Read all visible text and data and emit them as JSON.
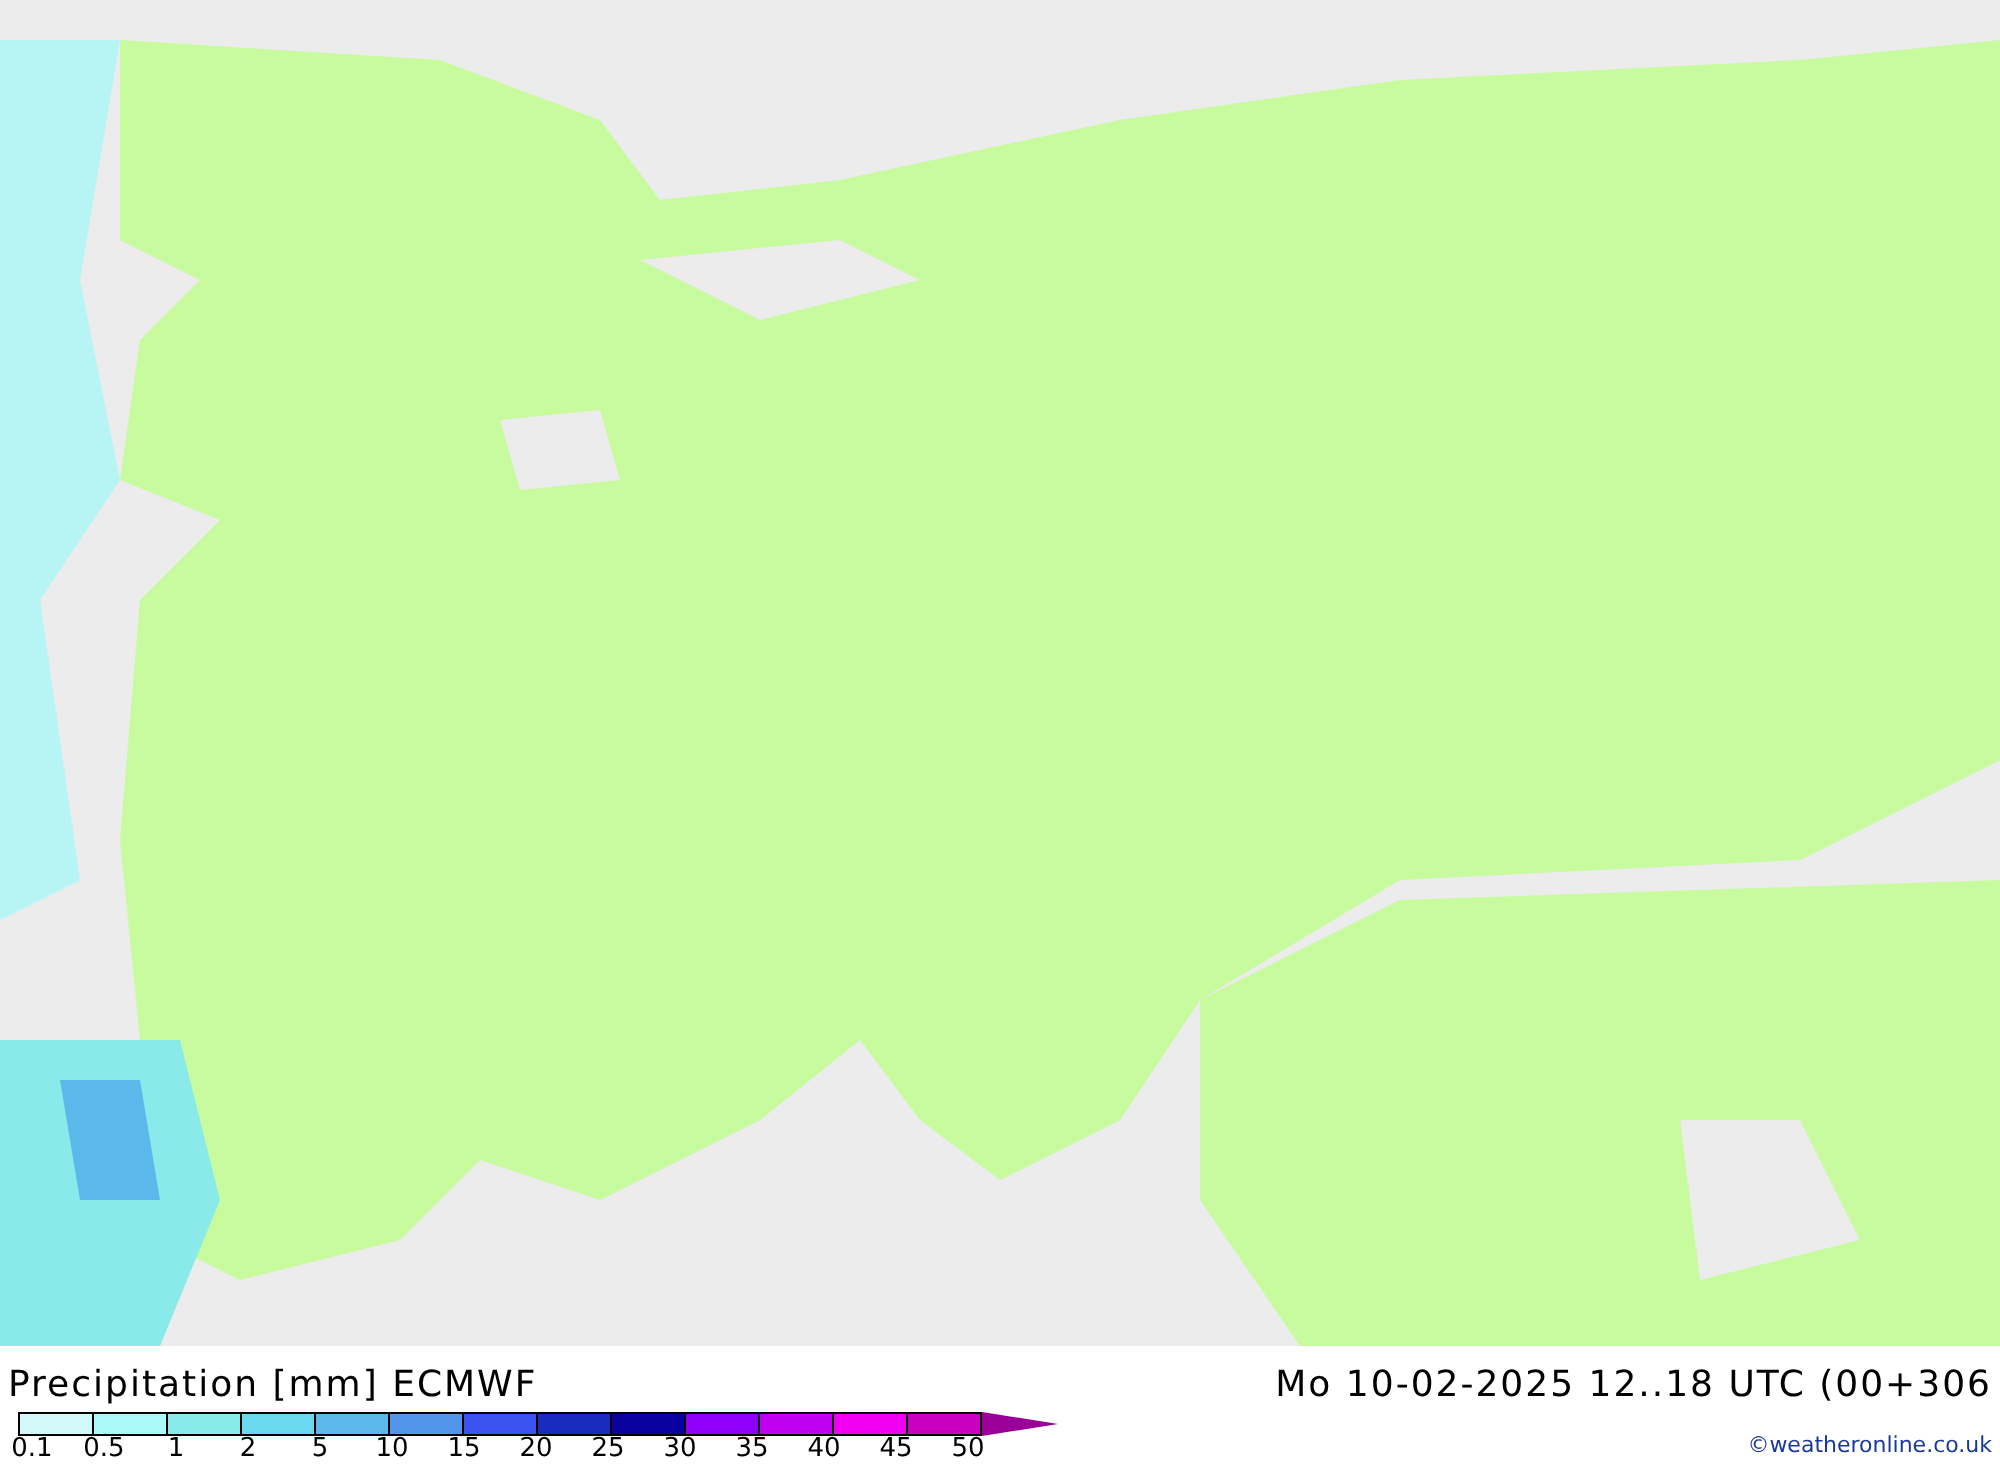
{
  "title": "Precipitation [mm] ECMWF",
  "valid_time": "Mo 10-02-2025 12..18 UTC (00+306",
  "legend": {
    "swatches": [
      {
        "color": "#d2f8f8"
      },
      {
        "color": "#aaf8f8"
      },
      {
        "color": "#8aeaea"
      },
      {
        "color": "#6ad8ee"
      },
      {
        "color": "#5ab8ea"
      },
      {
        "color": "#5294e8"
      },
      {
        "color": "#3a52f0"
      },
      {
        "color": "#1a2cc0"
      },
      {
        "color": "#0a00a0"
      },
      {
        "color": "#9000f8"
      },
      {
        "color": "#c000f0"
      },
      {
        "color": "#f000f0"
      },
      {
        "color": "#c800c0"
      },
      {
        "color": "#9a0098",
        "kind": "overflow"
      }
    ],
    "labels": [
      "0.1",
      "0.5",
      "1",
      "2",
      "5",
      "10",
      "15",
      "20",
      "25",
      "30",
      "35",
      "40",
      "45",
      "50"
    ]
  },
  "credit": "©weatheronline.co.uk"
}
